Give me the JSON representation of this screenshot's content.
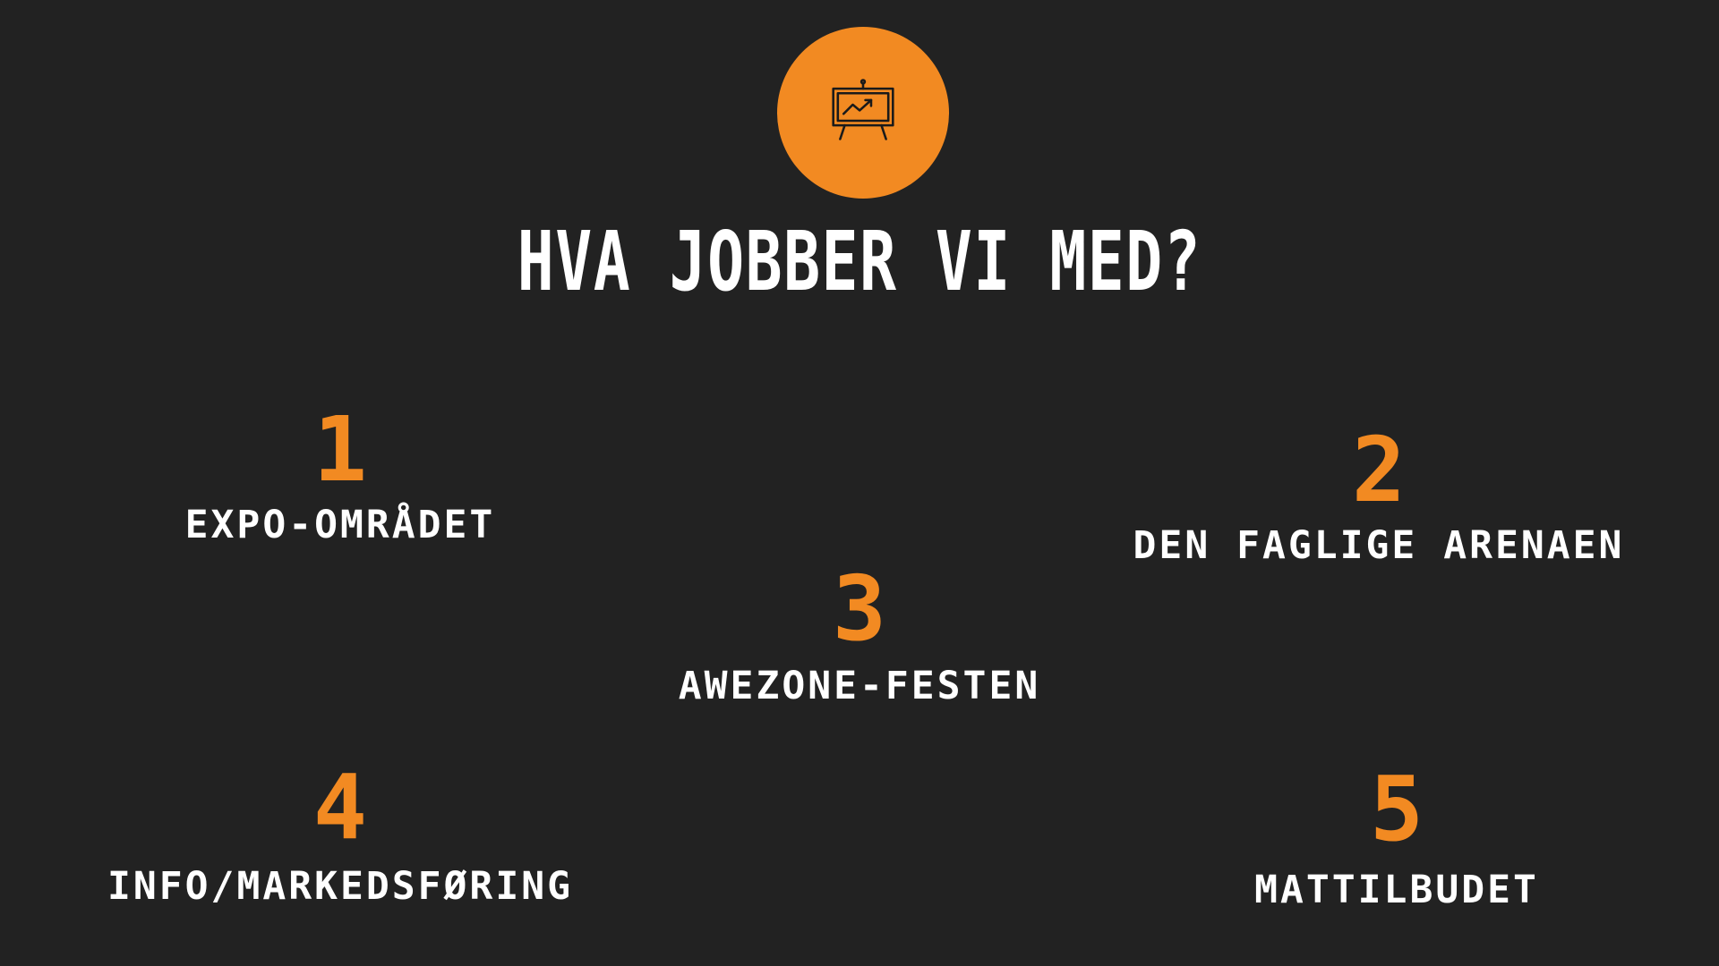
{
  "slide": {
    "icon": "presentation-chart-icon",
    "title": "HVA JOBBER VI MED?",
    "accent_color": "#f28a22",
    "background_color": "#222222",
    "items": [
      {
        "number": "1",
        "label": "EXPO-OMRÅDET"
      },
      {
        "number": "2",
        "label": "DEN FAGLIGE ARENAEN"
      },
      {
        "number": "3",
        "label": "AWEZONE-FESTEN"
      },
      {
        "number": "4",
        "label": "INFO/MARKEDSFØRING"
      },
      {
        "number": "5",
        "label": "MATTILBUDET"
      }
    ]
  }
}
